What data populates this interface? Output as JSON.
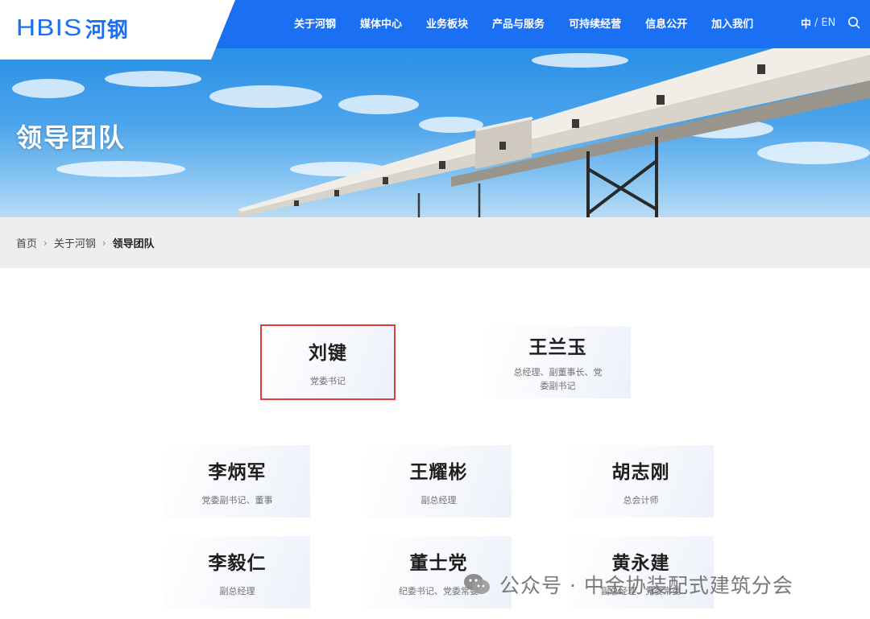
{
  "header": {
    "logo_latin": "HBIS",
    "logo_cn": "河钢",
    "nav": [
      "关于河钢",
      "媒体中心",
      "业务板块",
      "产品与服务",
      "可持续经营",
      "信息公开",
      "加入我们"
    ],
    "lang_cn": "中",
    "lang_sep": "/",
    "lang_en": "EN"
  },
  "banner": {
    "title": "领导团队"
  },
  "breadcrumb": {
    "home": "首页",
    "parent": "关于河钢",
    "current": "领导团队"
  },
  "leaders": [
    {
      "name": "刘键",
      "title": "党委书记"
    },
    {
      "name": "王兰玉",
      "title": "总经理、副董事长、党委副书记"
    },
    {
      "name": "李炳军",
      "title": "党委副书记、董事"
    },
    {
      "name": "王耀彬",
      "title": "副总经理"
    },
    {
      "name": "胡志刚",
      "title": "总会计师"
    },
    {
      "name": "李毅仁",
      "title": "副总经理"
    },
    {
      "name": "董士党",
      "title": "纪委书记、党委常委"
    },
    {
      "name": "黄永建",
      "title": "副总经理、党委常委"
    }
  ],
  "watermark": {
    "text": "公众号 · 中金协装配式建筑分会"
  },
  "colors": {
    "brand_blue": "#1a6ff2",
    "highlight_red": "#e03c3c",
    "crumb_bg": "#eeeeee"
  }
}
